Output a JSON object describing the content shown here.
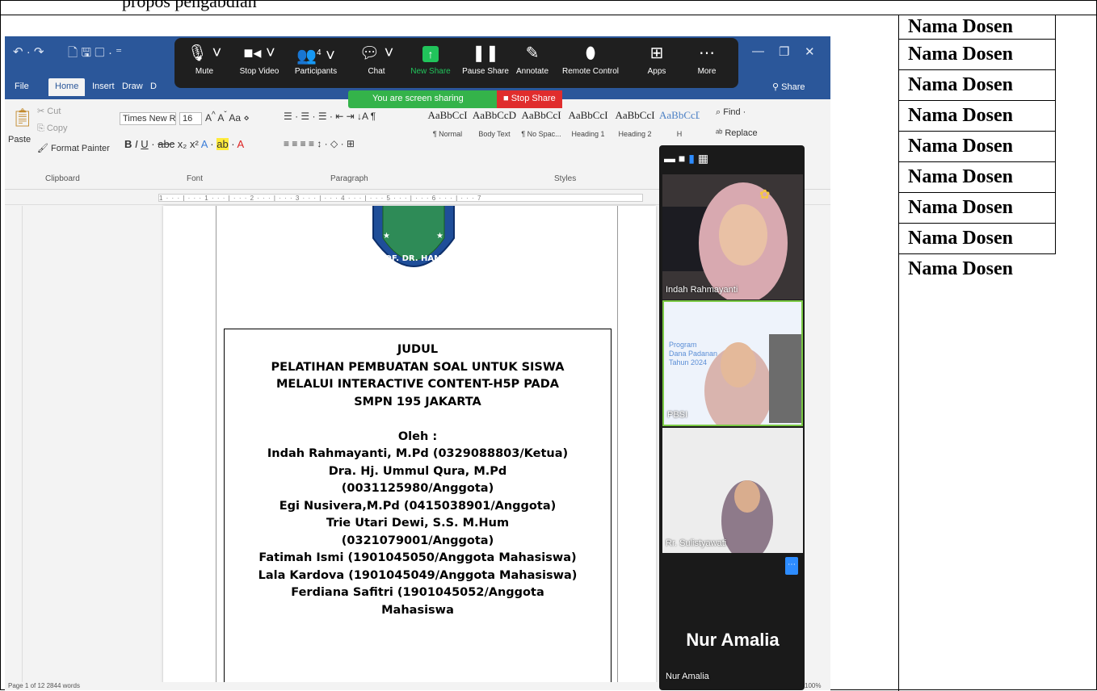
{
  "doc_top_text": "propos pengabdian",
  "names_column": [
    "Nama Dosen",
    "Nama Dosen",
    "Nama Dosen",
    "Nama Dosen",
    "Nama Dosen",
    "Nama Dosen",
    "Nama Dosen",
    "Nama Dosen",
    "Nama Dosen"
  ],
  "word": {
    "tabs": [
      "File",
      "Home",
      "Insert",
      "Draw",
      "D"
    ],
    "share": "Share",
    "clipboard": {
      "paste": "Paste",
      "cut": "Cut",
      "copy": "Copy",
      "format_painter": "Format Painter",
      "group": "Clipboard"
    },
    "font": {
      "name": "Times New Ror",
      "size": "16",
      "group": "Font"
    },
    "paragraph_group": "Paragraph",
    "styles": [
      {
        "preview": "AaBbCcI",
        "name": "¶ Normal"
      },
      {
        "preview": "AaBbCcD",
        "name": "Body Text"
      },
      {
        "preview": "AaBbCcI",
        "name": "¶ No Spac..."
      },
      {
        "preview": "AaBbCcI",
        "name": "Heading 1"
      },
      {
        "preview": "AaBbCcI",
        "name": "Heading 2"
      },
      {
        "preview": "AaBbCcDı",
        "name": "H"
      }
    ],
    "styles_group": "Styles",
    "find": "Find",
    "replace": "Replace",
    "status_left": "Page 1 of 12    2844 words",
    "zoom_level": "100%"
  },
  "zoom_toolbar": {
    "buttons": [
      {
        "label": "Mute",
        "icon": "microphone-icon"
      },
      {
        "label": "Stop Video",
        "icon": "video-icon"
      },
      {
        "label": "Participants",
        "icon": "participants-icon",
        "badge": "4"
      },
      {
        "label": "Chat",
        "icon": "chat-icon"
      },
      {
        "label": "New Share",
        "icon": "share-icon"
      },
      {
        "label": "Pause Share",
        "icon": "pause-icon"
      },
      {
        "label": "Annotate",
        "icon": "pen-icon"
      },
      {
        "label": "Remote Control",
        "icon": "mouse-icon"
      },
      {
        "label": "Apps",
        "icon": "apps-icon"
      },
      {
        "label": "More",
        "icon": "more-icon"
      }
    ],
    "sharing_text": "You are screen sharing",
    "stop_share": "Stop Share"
  },
  "document": {
    "lines": [
      "JUDUL",
      "PELATIHAN PEMBUATAN SOAL UNTUK SISWA",
      "MELALUI INTERACTIVE CONTENT-H5P PADA",
      "SMPN 195 JAKARTA",
      "",
      "Oleh :",
      "Indah Rahmayanti, M.Pd (0329088803/Ketua)",
      "Dra. Hj. Ummul Qura, M.Pd",
      "(0031125980/Anggota)",
      "Egi Nusivera,M.Pd (0415038901/Anggota)",
      "Trie Utari Dewi, S.S. M.Hum",
      "(0321079001/Anggota)",
      "Fatimah Ismi (1901045050/Anggota Mahasiswa)",
      "Lala Kardova (1901045049/Anggota Mahasiswa)",
      "Ferdiana Safitri (1901045052/Anggota",
      "Mahasiswa"
    ],
    "logo_text": "PROF. DR. HAMKA"
  },
  "participants": [
    {
      "name": "Indah Rahmayanti"
    },
    {
      "name": "PBSI",
      "slide_text": [
        "Program",
        "Dana Padanan",
        "Tahun 2024"
      ]
    },
    {
      "name": "Rr. Sulistyawati"
    },
    {
      "name": "Nur Amalia",
      "display": "Nur Amalia"
    }
  ],
  "colors": {
    "word_blue": "#2b579a",
    "zoom_green": "#21c35b",
    "stop_red": "#e02d2d"
  }
}
